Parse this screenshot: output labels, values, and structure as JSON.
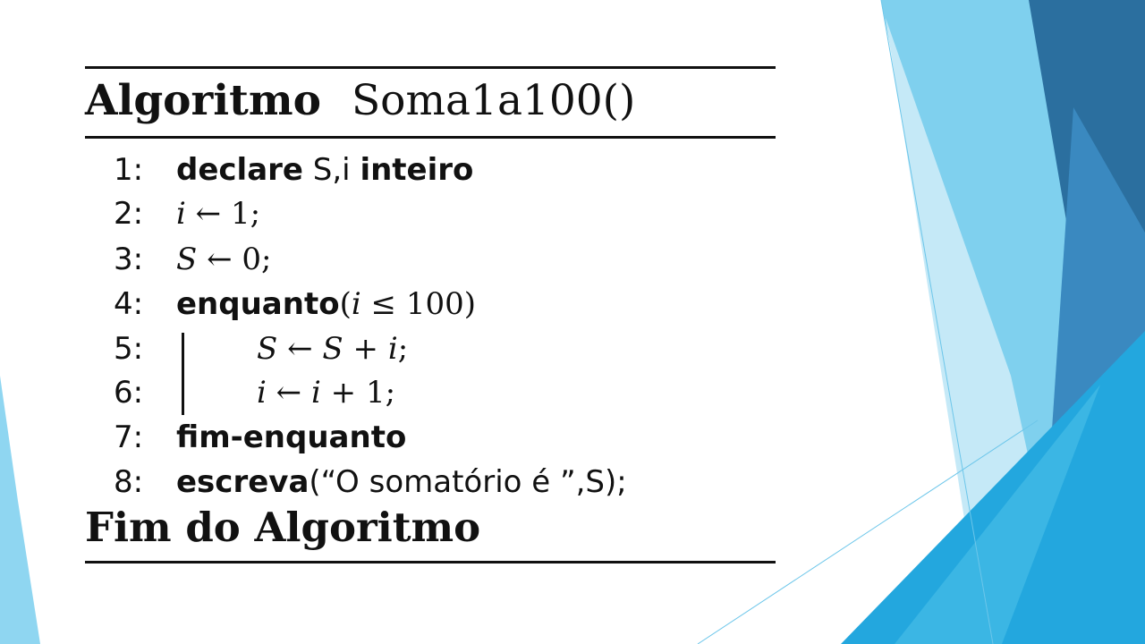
{
  "algorithm": {
    "header_keyword": "Algoritmo",
    "header_name": "Soma1a100()",
    "footer": "Fim do Algoritmo",
    "lines": [
      {
        "num": "1:",
        "parts": [
          "declare",
          " S,i ",
          "inteiro"
        ]
      },
      {
        "num": "2:",
        "parts": [
          "i",
          " ← ",
          "1",
          ";"
        ]
      },
      {
        "num": "3:",
        "parts": [
          "S",
          " ← ",
          "0",
          ";"
        ]
      },
      {
        "num": "4:",
        "parts": [
          "enquanto",
          "(",
          "i",
          " ≤ ",
          "100",
          ")"
        ]
      },
      {
        "num": "5:",
        "parts": [
          "S",
          " ← ",
          "S",
          " + ",
          "i",
          ";"
        ]
      },
      {
        "num": "6:",
        "parts": [
          "i",
          " ← ",
          "i",
          " + ",
          "1",
          ";"
        ]
      },
      {
        "num": "7:",
        "parts": [
          "fim-enquanto"
        ]
      },
      {
        "num": "8:",
        "parts": [
          "escreva",
          "(“O somatório é ”,S);"
        ]
      }
    ]
  },
  "theme": {
    "text_color": "#111111",
    "accent_light": "#bfe6f5",
    "accent_mid": "#7fd0ee",
    "accent_bright": "#29a9dc",
    "accent_dark": "#2a6f9e"
  }
}
